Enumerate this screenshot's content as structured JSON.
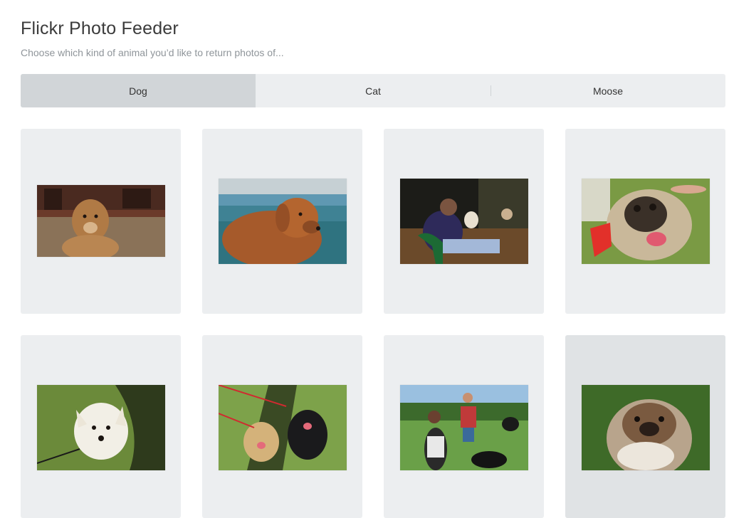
{
  "header": {
    "title": "Flickr Photo Feeder",
    "subtitle": "Choose which kind of animal you’d like to return photos of..."
  },
  "tabs": [
    {
      "label": "Dog",
      "active": true
    },
    {
      "label": "Cat",
      "active": false
    },
    {
      "label": "Moose",
      "active": false
    }
  ],
  "photos": [
    {
      "subject": "brown dog on rug"
    },
    {
      "subject": "golden retriever by pool"
    },
    {
      "subject": "man on bench with dogs"
    },
    {
      "subject": "pug with red frisbee"
    },
    {
      "subject": "white terrier on grass"
    },
    {
      "subject": "two dogs on leashes"
    },
    {
      "subject": "people and dogs in park"
    },
    {
      "subject": "pekingese on grass"
    }
  ]
}
